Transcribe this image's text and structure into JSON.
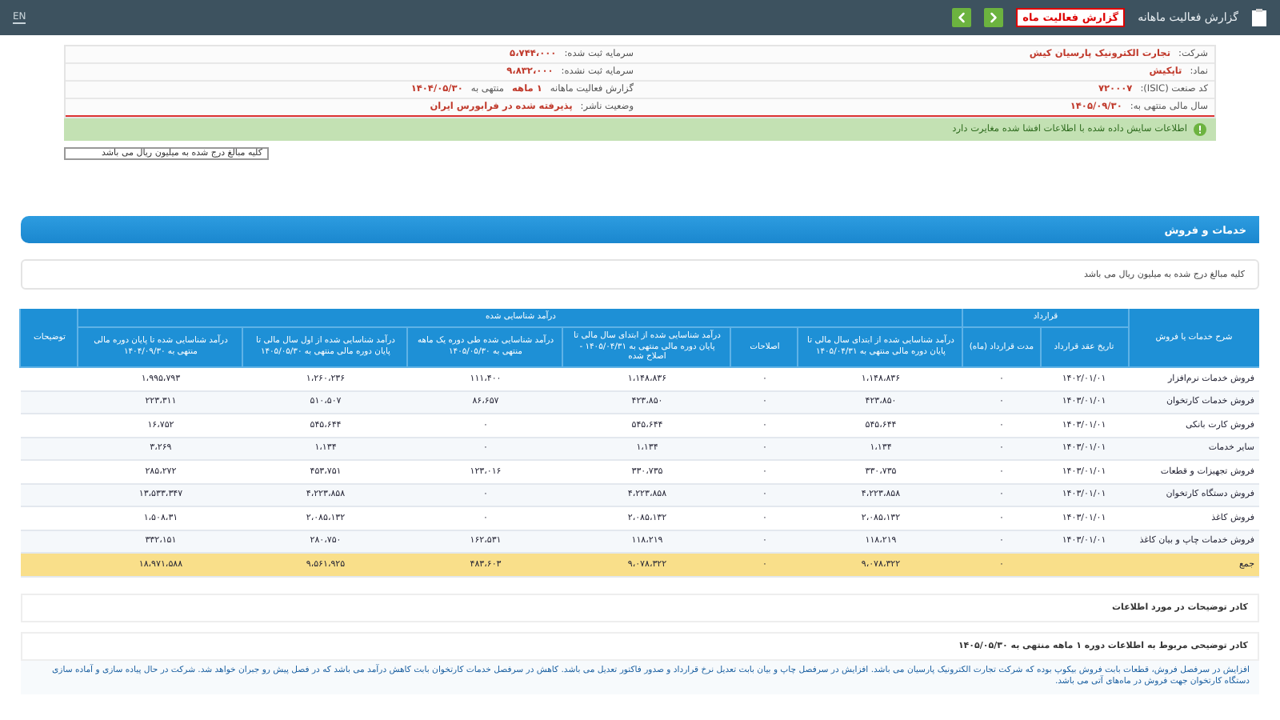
{
  "header": {
    "title": "گزارش فعالیت ماهانه",
    "report_badge": "گزارش فعالیت ماه",
    "language": "EN"
  },
  "info": {
    "rows": [
      {
        "right": [
          {
            "text": "شرکت:",
            "kind": "label"
          },
          {
            "text": "تجارت الکترونیک پارسیان کیش",
            "kind": "value"
          }
        ],
        "left": [
          {
            "text": "سرمایه ثبت شده:",
            "kind": "label"
          },
          {
            "text": "۵،۷۴۴،۰۰۰",
            "kind": "value"
          }
        ]
      },
      {
        "right": [
          {
            "text": "نماد:",
            "kind": "label"
          },
          {
            "text": "تاپکیش",
            "kind": "value"
          }
        ],
        "left": [
          {
            "text": "سرمایه ثبت نشده:",
            "kind": "label"
          },
          {
            "text": "۹،۸۳۲،۰۰۰",
            "kind": "value"
          }
        ]
      },
      {
        "right": [
          {
            "text": "کد صنعت (ISIC):",
            "kind": "label"
          },
          {
            "text": "۷۲۰۰۰۷",
            "kind": "value"
          }
        ],
        "left": [
          {
            "text": "گزارش فعالیت ماهانه",
            "kind": "label"
          },
          {
            "text": "۱ ماهه",
            "kind": "value"
          },
          {
            "text": "منتهی به",
            "kind": "label"
          },
          {
            "text": "۱۴۰۴/۰۵/۳۰",
            "kind": "value"
          }
        ]
      },
      {
        "right": [
          {
            "text": "سال مالی منتهی به:",
            "kind": "label"
          },
          {
            "text": "۱۴۰۵/۰۹/۳۰",
            "kind": "value"
          }
        ],
        "left": [
          {
            "text": "وضعیت ناشر:",
            "kind": "label"
          },
          {
            "text": "پذیرفته شده در فرابورس ایران",
            "kind": "value"
          }
        ]
      }
    ]
  },
  "notice": "اطلاعات سایش داده شده با اطلاعات افشا شده مغایرت دارد",
  "unit_note": "کلیه مبالغ درج شده به میلیون ریال می باشد",
  "section_title": "خدمات و فروش",
  "section_note": "کلیه مبالغ درج شده به میلیون ریال می باشد",
  "table": {
    "header_groups": [
      {
        "text": "شرح خدمات یا فروش",
        "kind": "single"
      },
      {
        "text": "قرارداد",
        "kind": "group",
        "columns": [
          "تاریخ عقد قرارداد",
          "مدت قرارداد (ماه)"
        ]
      },
      {
        "text": "درآمد شناسایی شده",
        "kind": "group",
        "columns": [
          "درآمد شناسایی شده از ابتدای سال مالی تا پایان دوره مالی منتهی به ۱۴۰۵/۰۴/۳۱",
          "اصلاحات",
          "درآمد شناسایی شده از ابتدای سال مالی تا پایان دوره مالی منتهی به ۱۴۰۵/۰۴/۳۱ - اصلاح شده",
          "درآمد شناسایی شده طی دوره یک ماهه منتهی به ۱۴۰۵/۰۵/۳۰",
          "درآمد شناسایی شده از اول سال مالی تا پایان دوره مالی منتهی به ۱۴۰۵/۰۵/۳۰",
          "درآمد شناسایی شده تا پایان دوره مالی منتهی به ۱۴۰۴/۰۹/۳۰"
        ]
      },
      {
        "text": "توضیحات",
        "kind": "single"
      }
    ],
    "rows": [
      {
        "kind": "item",
        "cells": [
          "فروش خدمات نرم‌افزار",
          "۱۴۰۲/۰۱/۰۱",
          "۰",
          "۱،۱۴۸،۸۳۶",
          "۰",
          "۱،۱۴۸،۸۳۶",
          "۱۱۱،۴۰۰",
          "۱،۲۶۰،۲۳۶",
          "۱،۹۹۵،۷۹۳"
        ]
      },
      {
        "kind": "item",
        "cells": [
          "فروش خدمات کارتخوان",
          "۱۴۰۳/۰۱/۰۱",
          "۰",
          "۴۲۳،۸۵۰",
          "۰",
          "۴۲۳،۸۵۰",
          "۸۶،۶۵۷",
          "۵۱۰،۵۰۷",
          "۲۲۳،۳۱۱"
        ]
      },
      {
        "kind": "item",
        "cells": [
          "فروش کارت بانکی",
          "۱۴۰۳/۰۱/۰۱",
          "۰",
          "۵۴۵،۶۴۴",
          "۰",
          "۵۴۵،۶۴۴",
          "۰",
          "۵۴۵،۶۴۴",
          "۱۶،۷۵۲"
        ]
      },
      {
        "kind": "item",
        "cells": [
          "سایر خدمات",
          "۱۴۰۳/۰۱/۰۱",
          "۰",
          "۱،۱۳۴",
          "۰",
          "۱،۱۳۴",
          "۰",
          "۱،۱۳۴",
          "۳،۲۶۹"
        ]
      },
      {
        "kind": "item",
        "cells": [
          "فروش تجهیزات و قطعات",
          "۱۴۰۳/۰۱/۰۱",
          "۰",
          "۳۳۰،۷۳۵",
          "۰",
          "۳۳۰،۷۳۵",
          "۱۲۳،۰۱۶",
          "۴۵۳،۷۵۱",
          "۲۸۵،۲۷۲"
        ]
      },
      {
        "kind": "item",
        "cells": [
          "فروش دستگاه کارتخوان",
          "۱۴۰۳/۰۱/۰۱",
          "۰",
          "۴،۲۲۳،۸۵۸",
          "۰",
          "۴،۲۲۳،۸۵۸",
          "۰",
          "۴،۲۲۳،۸۵۸",
          "۱۳،۵۳۳،۳۴۷"
        ]
      },
      {
        "kind": "item",
        "cells": [
          "فروش کاغذ",
          "۱۴۰۳/۰۱/۰۱",
          "۰",
          "۲،۰۸۵،۱۳۲",
          "۰",
          "۲،۰۸۵،۱۳۲",
          "۰",
          "۲،۰۸۵،۱۳۲",
          "۱،۵۰۸،۳۱"
        ]
      },
      {
        "kind": "item",
        "cells": [
          "فروش خدمات چاپ و بیان کاغذ",
          "۱۴۰۳/۰۱/۰۱",
          "۰",
          "۱۱۸،۲۱۹",
          "۰",
          "۱۱۸،۲۱۹",
          "۱۶۲،۵۳۱",
          "۲۸۰،۷۵۰",
          "۳۳۲،۱۵۱"
        ]
      },
      {
        "kind": "total",
        "cells": [
          "جمع",
          "",
          "۰",
          "۹،۰۷۸،۳۲۲",
          "۰",
          "۹،۰۷۸،۳۲۲",
          "۴۸۳،۶۰۳",
          "۹،۵۶۱،۹۲۵",
          "۱۸،۹۷۱،۵۸۸"
        ]
      }
    ]
  },
  "notes": {
    "title": "کادر توضیحات در مورد اطلاعات",
    "period_title": "کادر توضیحی مربوط به اطلاعات دوره ۱ ماهه منتهی به ۱۴۰۵/۰۵/۳۰",
    "text": "افزایش در سرفصل فروش، قطعات بابت فروش بیکوپ بوده که شرکت تجارت الکترونیک پارسیان می باشد. افزایش در سرفصل چاپ و بیان بابت تعدیل نرخ قرارداد و صدور فاکتور تعدیل می باشد. کاهش در سرفصل خدمات کارتخوان بابت کاهش درآمد می باشد که در فصل پیش رو جبران خواهد شد. شرکت در حال پیاده سازی و آماده سازی دستگاه کارتخوان جهت فروش در ماه‌های آتی می باشد."
  }
}
